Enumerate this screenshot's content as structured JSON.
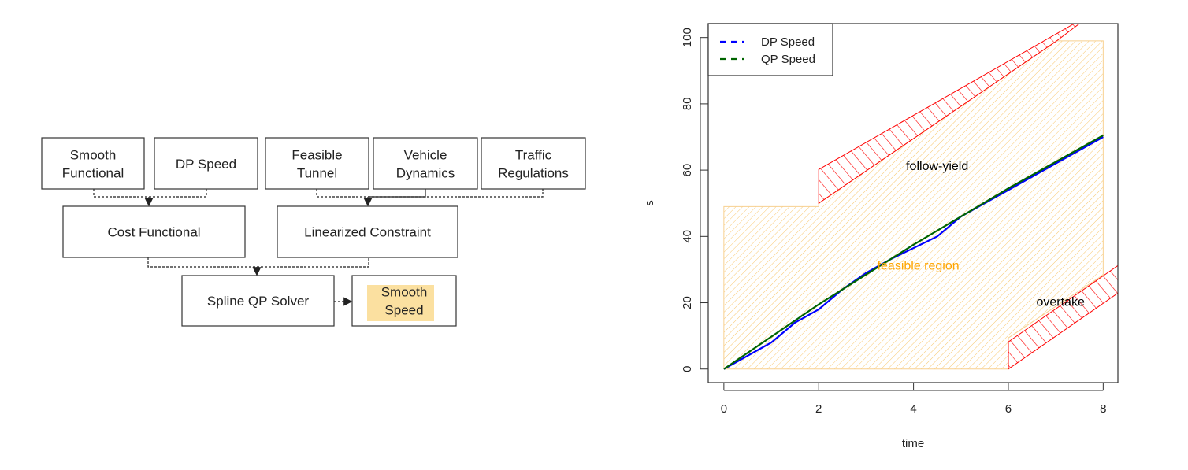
{
  "diagram": {
    "inputs": [
      "Smooth\nFunctional",
      "DP Speed",
      "Feasible\nTunnel",
      "Vehicle\nDynamics",
      "Traffic\nRegulations"
    ],
    "cost": "Cost Functional",
    "constraint": "Linearized Constraint",
    "solver": "Spline QP Solver",
    "output": "Smooth\nSpeed",
    "highlight_color": "#fbe0a0"
  },
  "chart_data": {
    "type": "line",
    "xlabel": "time",
    "ylabel": "s",
    "xlim": [
      -0.33,
      8.31
    ],
    "ylim": [
      -4.1,
      104.2
    ],
    "xticks": [
      0,
      2,
      4,
      6,
      8
    ],
    "yticks": [
      0,
      20,
      40,
      60,
      80,
      100
    ],
    "grid": false,
    "legend": {
      "position": "top-left",
      "entries": [
        "DP Speed",
        "QP Speed"
      ]
    },
    "series": [
      {
        "name": "DP Speed",
        "color": "#0000ff",
        "x": [
          0,
          1,
          1.5,
          2,
          2.5,
          3,
          3.5,
          4,
          4.5,
          5,
          6,
          7,
          8
        ],
        "y": [
          0,
          8,
          14,
          18,
          24,
          29,
          33,
          36.5,
          40,
          46,
          54,
          62,
          70
        ]
      },
      {
        "name": "QP Speed",
        "color": "#006400",
        "x": [
          0,
          2,
          4,
          5,
          6,
          7,
          8
        ],
        "y": [
          0,
          19.5,
          37.5,
          46,
          54.5,
          62.5,
          70.5
        ]
      }
    ],
    "regions": [
      {
        "label": "feasible region",
        "label_color": "#ffa500",
        "hatch_color": "#f5c060",
        "label_at": [
          4.1,
          30
        ],
        "polygon": [
          [
            0,
            0
          ],
          [
            0,
            49
          ],
          [
            2,
            49
          ],
          [
            2,
            50
          ],
          [
            7.02,
            99
          ],
          [
            8,
            99
          ],
          [
            8,
            28.4
          ],
          [
            6,
            9.4
          ],
          [
            6,
            0
          ]
        ]
      },
      {
        "label": "follow-yield",
        "label_color": "#000000",
        "hatch_color": "#ff0000",
        "label_at": [
          4.5,
          60
        ],
        "polygon": [
          [
            2,
            50
          ],
          [
            2,
            60.2
          ],
          [
            7.39,
            104.2
          ],
          [
            7.5,
            104.2
          ],
          [
            7.02,
            99
          ],
          [
            2,
            50
          ]
        ]
      },
      {
        "label": "overtake",
        "label_color": "#000000",
        "hatch_color": "#ff0000",
        "label_at": [
          7.1,
          19
        ],
        "polygon": [
          [
            6,
            0
          ],
          [
            6,
            8.2
          ],
          [
            8.31,
            31.2
          ],
          [
            8.31,
            22.9
          ]
        ]
      }
    ]
  }
}
